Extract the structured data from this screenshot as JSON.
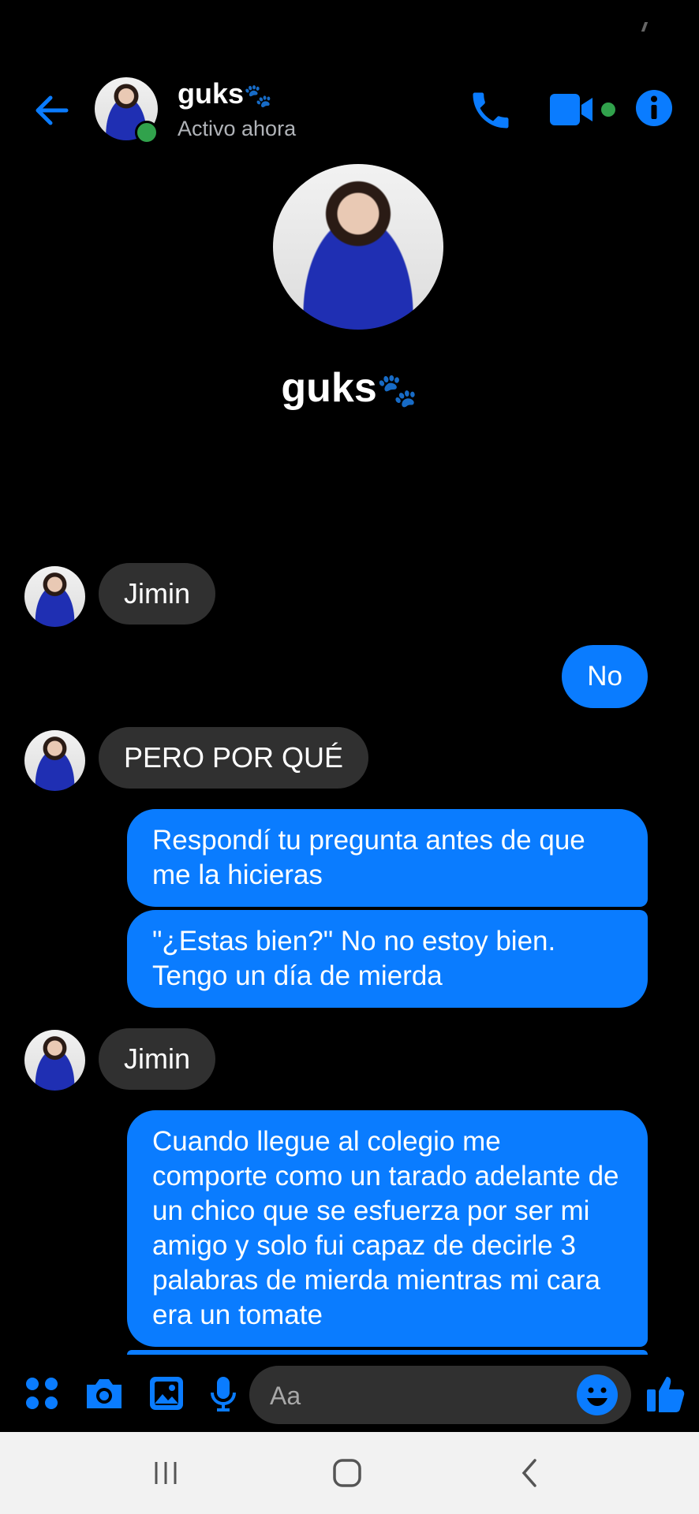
{
  "header": {
    "contact_name": "guks",
    "name_emoji": "🐾",
    "status": "Activo ahora"
  },
  "profile": {
    "name": "guks",
    "name_emoji": "🐾"
  },
  "messages": [
    {
      "direction": "in",
      "text": "Jimin"
    },
    {
      "direction": "out",
      "text": "No"
    },
    {
      "direction": "in",
      "text": "PERO POR QUÉ"
    },
    {
      "direction": "out",
      "text": "Respondí tu pregunta antes de que me la hicieras"
    },
    {
      "direction": "out",
      "text": "\"¿Estas bien?\" No no estoy bien. Tengo un día de mierda"
    },
    {
      "direction": "in",
      "text": "Jimin"
    },
    {
      "direction": "out",
      "text": "Cuando llegue al colegio me comporte como un tarado adelante de un chico que se esfuerza por ser mi amigo y solo fui capaz de decirle 3 palabras de mierda  mientras mi cara era un tomate"
    }
  ],
  "composer": {
    "placeholder": "Aa",
    "icons": [
      "apps-icon",
      "camera-icon",
      "gallery-icon",
      "microphone-icon",
      "emoji-icon",
      "like-icon"
    ]
  },
  "colors": {
    "accent": "#0a7cff",
    "incoming_bubble": "#303030",
    "online": "#31a24c",
    "background": "#000000"
  },
  "navbar": {
    "icons": [
      "recent-apps-icon",
      "home-icon",
      "back-nav-icon"
    ]
  }
}
